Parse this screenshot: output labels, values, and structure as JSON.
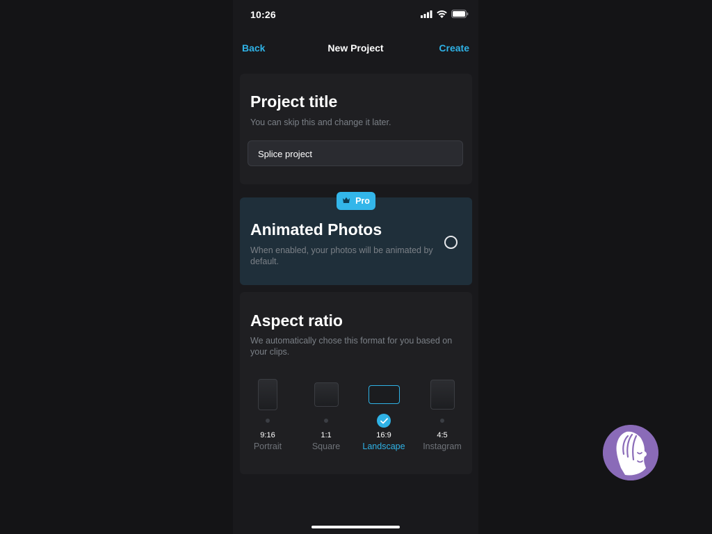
{
  "status_bar": {
    "time": "10:26",
    "icons": [
      "signal-icon",
      "wifi-icon",
      "battery-icon"
    ]
  },
  "nav": {
    "back_label": "Back",
    "title": "New Project",
    "create_label": "Create"
  },
  "project_title": {
    "heading": "Project title",
    "subtitle": "You can skip this and change it later.",
    "input_value": "Splice project"
  },
  "animated_photos": {
    "badge_label": "Pro",
    "badge_icon": "crown-icon",
    "heading": "Animated Photos",
    "description": "When enabled, your photos will be animated by default.",
    "enabled": false
  },
  "aspect_ratio": {
    "heading": "Aspect ratio",
    "subtitle": "We automatically chose this format for you based on your clips.",
    "options": [
      {
        "ratio": "9:16",
        "label": "Portrait",
        "selected": false
      },
      {
        "ratio": "1:1",
        "label": "Square",
        "selected": false
      },
      {
        "ratio": "16:9",
        "label": "Landscape",
        "selected": true
      },
      {
        "ratio": "4:5",
        "label": "Instagram",
        "selected": false
      }
    ]
  },
  "colors": {
    "accent": "#2fb2e6",
    "background": "#19191c",
    "card": "#1f1f22",
    "pro_card": "#1f2f3a",
    "assistant_bubble": "#8a6bb8"
  }
}
